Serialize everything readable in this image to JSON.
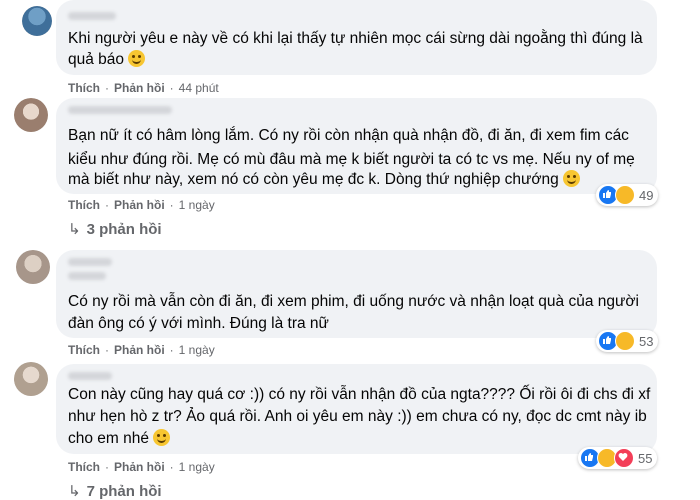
{
  "comments": [
    {
      "lines": [
        "Khi người yêu e này về có khi lại thấy tự nhiên mọc cái sừng dài ngoằng thì đúng là",
        "quả báo"
      ],
      "like_label": "Thích",
      "reply_label": "Phản hồi",
      "time": "44 phút"
    },
    {
      "lines": [
        "Bạn nữ ít có hâm lòng lắm. Có ny rồi còn nhận quà nhận đồ, đi ăn, đi xem fim các",
        "kiểu như đúng rồi. Mẹ có mù đâu mà mẹ k biết người ta có tc vs mẹ. Nếu ny of mẹ",
        "mà biết như này, xem nó có còn yêu mẹ đc k. Dòng thứ nghiệp chướng"
      ],
      "like_label": "Thích",
      "reply_label": "Phản hồi",
      "time": "1 ngày",
      "reaction_count": "49",
      "replies": "3 phản hồi"
    },
    {
      "lines": [
        "Có ny rồi mà vẫn còn đi ăn, đi xem phim, đi uống nước và nhận loạt quà của người",
        "đàn ông có ý với mình. Đúng là tra nữ"
      ],
      "like_label": "Thích",
      "reply_label": "Phản hồi",
      "time": "1 ngày",
      "reaction_count": "53"
    },
    {
      "lines": [
        "Con này cũng hay quá cơ :)) có ny rồi vẫn nhận đồ của ngta???? Ối rồi ôi đi chs đi xf",
        "như hẹn hò z tr? Ảo quá rồi. Anh oi yêu em này :)) em chưa có ny, đọc dc cmt này ib",
        "cho em nhé"
      ],
      "like_label": "Thích",
      "reply_label": "Phản hồi",
      "time": "1 ngày",
      "reaction_count": "55",
      "replies": "7 phản hồi"
    }
  ],
  "icons": {
    "like": "like-reaction-icon",
    "haha": "haha-reaction-icon",
    "love": "love-reaction-icon",
    "reply_arrow": "reply-arrow-icon"
  },
  "colors": {
    "bubble": "#f0f2f5",
    "meta": "#65676b",
    "like": "#1877f2",
    "haha": "#f7b928",
    "love": "#f33e58"
  }
}
